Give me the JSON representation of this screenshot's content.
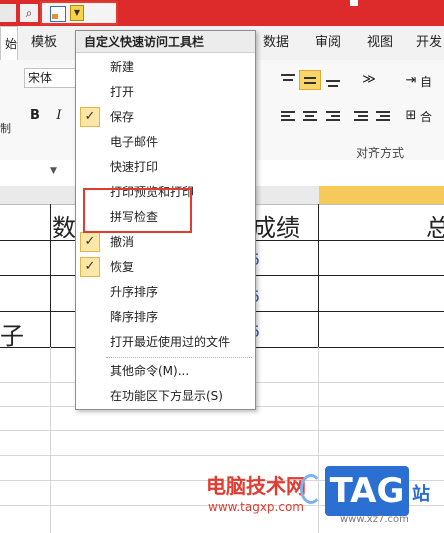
{
  "quick_access": {
    "binocular_icon": "binoculars-icon",
    "form_icon": "form-icon",
    "dropdown_icon": "customize-dropdown-icon"
  },
  "tabs": {
    "active_fragment": "始",
    "template": "模板",
    "data": "数据",
    "review": "审阅",
    "view": "视图",
    "developer": "开发"
  },
  "ribbon": {
    "font_name": "宋体",
    "bold": "B",
    "italic": "I",
    "left_fragment": "制",
    "alignment_group": "对齐方式",
    "autowrap_fragment": "自",
    "merge_fragment": "合"
  },
  "sheet": {
    "header_math": "数",
    "header_score": "成绩",
    "header_total": "总",
    "row_fragment": "子",
    "blue_marks": [
      "5",
      "5",
      "5"
    ]
  },
  "menu": {
    "title": "自定义快速访问工具栏",
    "items": [
      {
        "label": "新建",
        "checked": false
      },
      {
        "label": "打开",
        "checked": false
      },
      {
        "label": "保存",
        "checked": true
      },
      {
        "label": "电子邮件",
        "checked": false
      },
      {
        "label": "快速打印",
        "checked": false
      },
      {
        "label": "打印预览和打印",
        "checked": false
      },
      {
        "label": "拼写检查",
        "checked": false
      },
      {
        "label": "撤消",
        "checked": true
      },
      {
        "label": "恢复",
        "checked": true
      },
      {
        "label": "升序排序",
        "checked": false
      },
      {
        "label": "降序排序",
        "checked": false
      },
      {
        "label": "打开最近使用过的文件",
        "checked": false
      },
      {
        "label": "其他命令(M)...",
        "checked": false
      },
      {
        "label": "在功能区下方显示(S)",
        "checked": false
      }
    ],
    "check_glyph": "✓"
  },
  "watermark": {
    "site_name": "电脑技术网",
    "url": "www.tagxp.com",
    "tag": "TAG",
    "zhan": "站",
    "small": "www.xz7.com"
  },
  "colors": {
    "accent_red": "#e23b30",
    "qat_red": "#dd2a2a",
    "check_bg": "#fde7a8",
    "selected_col": "#f6c95b",
    "tag_blue": "#2a6fd1"
  }
}
